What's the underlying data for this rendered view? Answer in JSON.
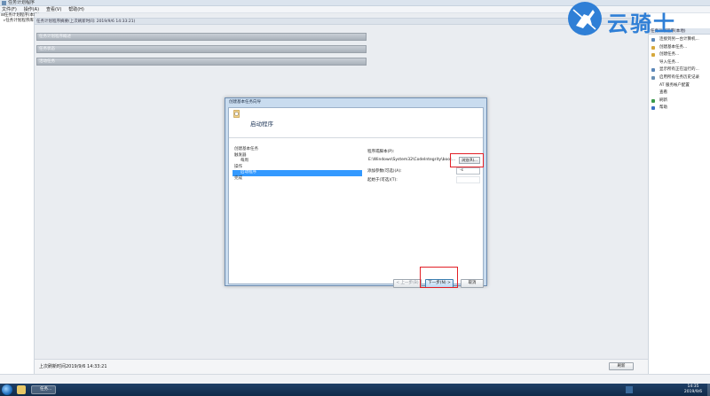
{
  "window": {
    "title": "任务计划程序"
  },
  "menu": [
    "文件(F)",
    "操作(A)",
    "查看(V)",
    "帮助(H)"
  ],
  "tree": {
    "root": "任务计划程序(本地)",
    "child": "任务计划程序库"
  },
  "center": {
    "header": "任务计划程序摘要(上次刷新时间: 2019/9/6 14:33:21)",
    "sections": [
      "任务计划程序概述",
      "任务状态",
      "活动任务"
    ],
    "last_refresh": "上次刷新时间2019/9/6 14:33:21",
    "refresh_label": "刷新"
  },
  "actions_pane": {
    "header": "任务计划程序(本地)",
    "items": [
      {
        "label": "连接到另一台计算机...",
        "icon": "computer-icon",
        "color": "#5b86b8"
      },
      {
        "label": "创建基本任务...",
        "icon": "basic-task-icon",
        "color": "#d6a83c"
      },
      {
        "label": "创建任务...",
        "icon": "task-icon",
        "color": "#d6a83c"
      },
      {
        "label": "导入任务...",
        "icon": "",
        "color": ""
      },
      {
        "label": "显示所有正在运行的...",
        "icon": "running-tasks-icon",
        "color": "#5b86b8"
      },
      {
        "label": "启用所有任务历史记录",
        "icon": "history-icon",
        "color": "#6a8fb3"
      },
      {
        "label": "AT 服务帐户配置",
        "icon": "",
        "color": ""
      },
      {
        "label": "查看",
        "icon": "",
        "color": ""
      },
      {
        "label": "刷新",
        "icon": "refresh-icon",
        "color": "#3a9a4a"
      },
      {
        "label": "帮助",
        "icon": "help-icon",
        "color": "#3b6fc4"
      }
    ]
  },
  "watermark": {
    "text": "云骑士"
  },
  "dialog": {
    "title": "创建基本任务向导",
    "heading": "启动程序",
    "steps": [
      {
        "label": "创建基本任务",
        "sub": false,
        "active": false
      },
      {
        "label": "触发器",
        "sub": false,
        "active": false
      },
      {
        "label": "每周",
        "sub": true,
        "active": false
      },
      {
        "label": "操作",
        "sub": false,
        "active": false
      },
      {
        "label": "启动程序",
        "sub": true,
        "active": true
      },
      {
        "label": "完成",
        "sub": false,
        "active": false
      }
    ],
    "program_label": "程序或脚本(P):",
    "program_value": "E:\\Windows\\System32\\CodeIntegrity\\boot...",
    "browse_label": "浏览(R)...",
    "args_label": "添加参数(可选)(A):",
    "args_value": "-s",
    "start_in_label": "起始于(可选)(T):",
    "start_in_value": "",
    "back_label": "< 上一步(B)",
    "next_label": "下一步(N) >",
    "cancel_label": "取消"
  },
  "taskbar": {
    "task_label": "任务...",
    "time": "14:35",
    "date": "2019/9/6"
  }
}
